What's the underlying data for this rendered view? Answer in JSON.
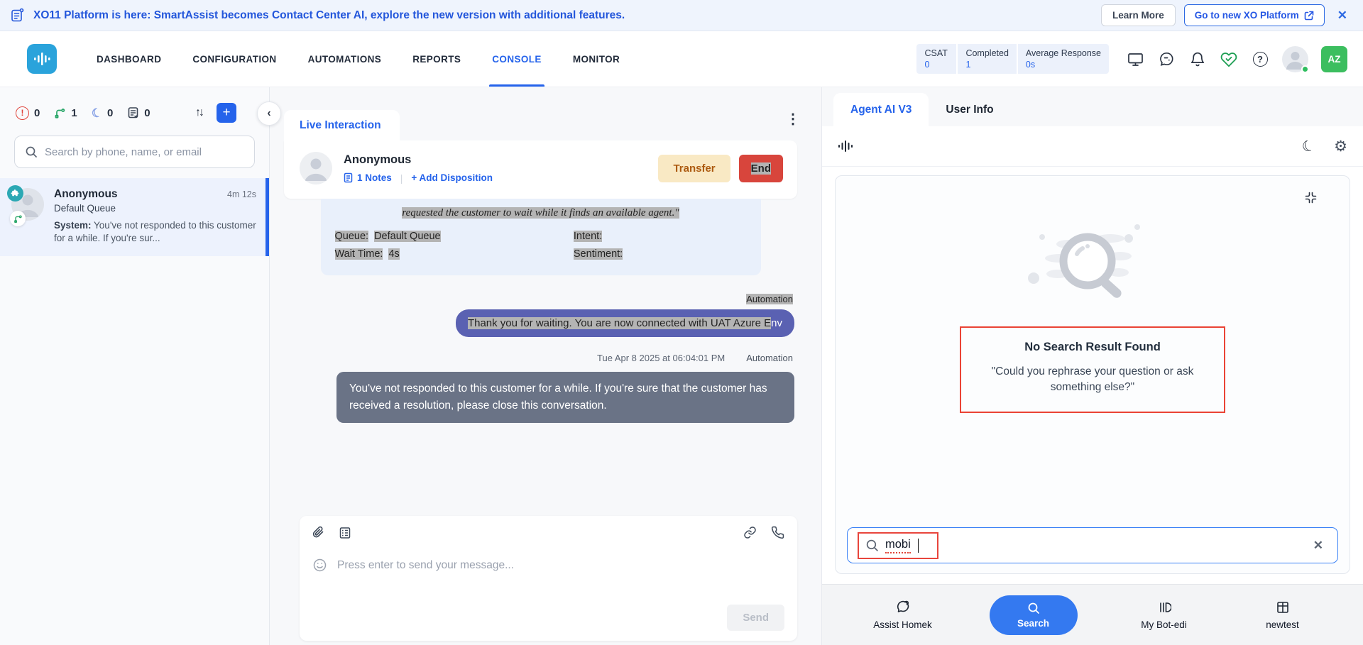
{
  "banner": {
    "text": "XO11 Platform is here: SmartAssist becomes Contact Center AI, explore the new version with additional features.",
    "learn_more": "Learn More",
    "go_new": "Go to new XO Platform",
    "close": "✕"
  },
  "nav": {
    "items": [
      "DASHBOARD",
      "CONFIGURATION",
      "AUTOMATIONS",
      "REPORTS",
      "CONSOLE",
      "MONITOR"
    ],
    "stats": [
      {
        "label": "CSAT",
        "value": "0"
      },
      {
        "label": "Completed",
        "value": "1"
      },
      {
        "label": "Average Response",
        "value": "0s"
      }
    ],
    "avatar_badge": "AZ",
    "question_mark": "?"
  },
  "sidebar": {
    "counters": [
      {
        "name": "alerts",
        "value": "0"
      },
      {
        "name": "active-flows",
        "value": "1"
      },
      {
        "name": "snoozed",
        "value": "0"
      },
      {
        "name": "notes",
        "value": "0"
      }
    ],
    "alert_glyph": "!",
    "moon_glyph": "☾",
    "sort_glyph": "↑↓",
    "plus_glyph": "+",
    "collapse_glyph": "‹",
    "search_placeholder": "Search by phone, name, or email",
    "conversation": {
      "name": "Anonymous",
      "duration": "4m 12s",
      "queue": "Default Queue",
      "system_label": "System:",
      "system_text": " You've not responded to this customer for a while. If you're sur..."
    }
  },
  "chat": {
    "tab": "Live Interaction",
    "kebab": "⋮",
    "name": "Anonymous",
    "notes_link": "1 Notes",
    "divider": "|",
    "add_disposition": "+ Add Disposition",
    "transfer": "Transfer",
    "end": "End",
    "info_line": "requested the customer to wait while it finds an available agent.\"",
    "fields": {
      "queue_label": "Queue:",
      "queue_value": "Default Queue",
      "intent_label": "Intent:",
      "wait_label": "Wait Time:",
      "wait_value": "4s",
      "sentiment_label": "Sentiment:"
    },
    "automation_label": "Automation",
    "bubble_selected": "Thank you for waiting. You are now connected with UAT Azure E",
    "bubble_tail": "nv",
    "timestamp": "Tue Apr 8 2025 at 06:04:01 PM",
    "automation_label2": "Automation",
    "gray_message": "You've not responded to this customer for a while. If you're sure that the customer has received a resolution, please close this conversation.",
    "composer_placeholder": "Press enter to send your message...",
    "smiley_glyph": "☺",
    "send": "Send"
  },
  "agent_panel": {
    "tabs": [
      {
        "label": "Agent AI V3"
      },
      {
        "label": "User Info"
      }
    ],
    "moon_glyph": "☾",
    "gear_glyph": "⚙",
    "no_result_title": "No Search Result Found",
    "no_result_quote": "\"Could you rephrase your question or ask something else?\"",
    "search_value": "mobi",
    "clear_glyph": "✕",
    "bottom_tabs": [
      {
        "label": "Assist Homek"
      },
      {
        "label": "Search"
      },
      {
        "label": "My Bot-edi"
      },
      {
        "label": "newtest"
      }
    ]
  },
  "colors": {
    "accent_blue": "#2563EB",
    "banner_blue": "#2356DB",
    "logo_blue": "#2AA3DB",
    "bubble_indigo": "#5A61B2",
    "bubble_gray": "#6A7386",
    "transfer_bg": "#F9E9C4",
    "transfer_text": "#AC5A0F",
    "end_red": "#D8453C",
    "annotation_red": "#EA4335",
    "success_green": "#3CBE5F",
    "teal_badge": "#2BA8B4",
    "selection_gray": "#B4B4B4",
    "search_pill_blue": "#3479F0"
  }
}
